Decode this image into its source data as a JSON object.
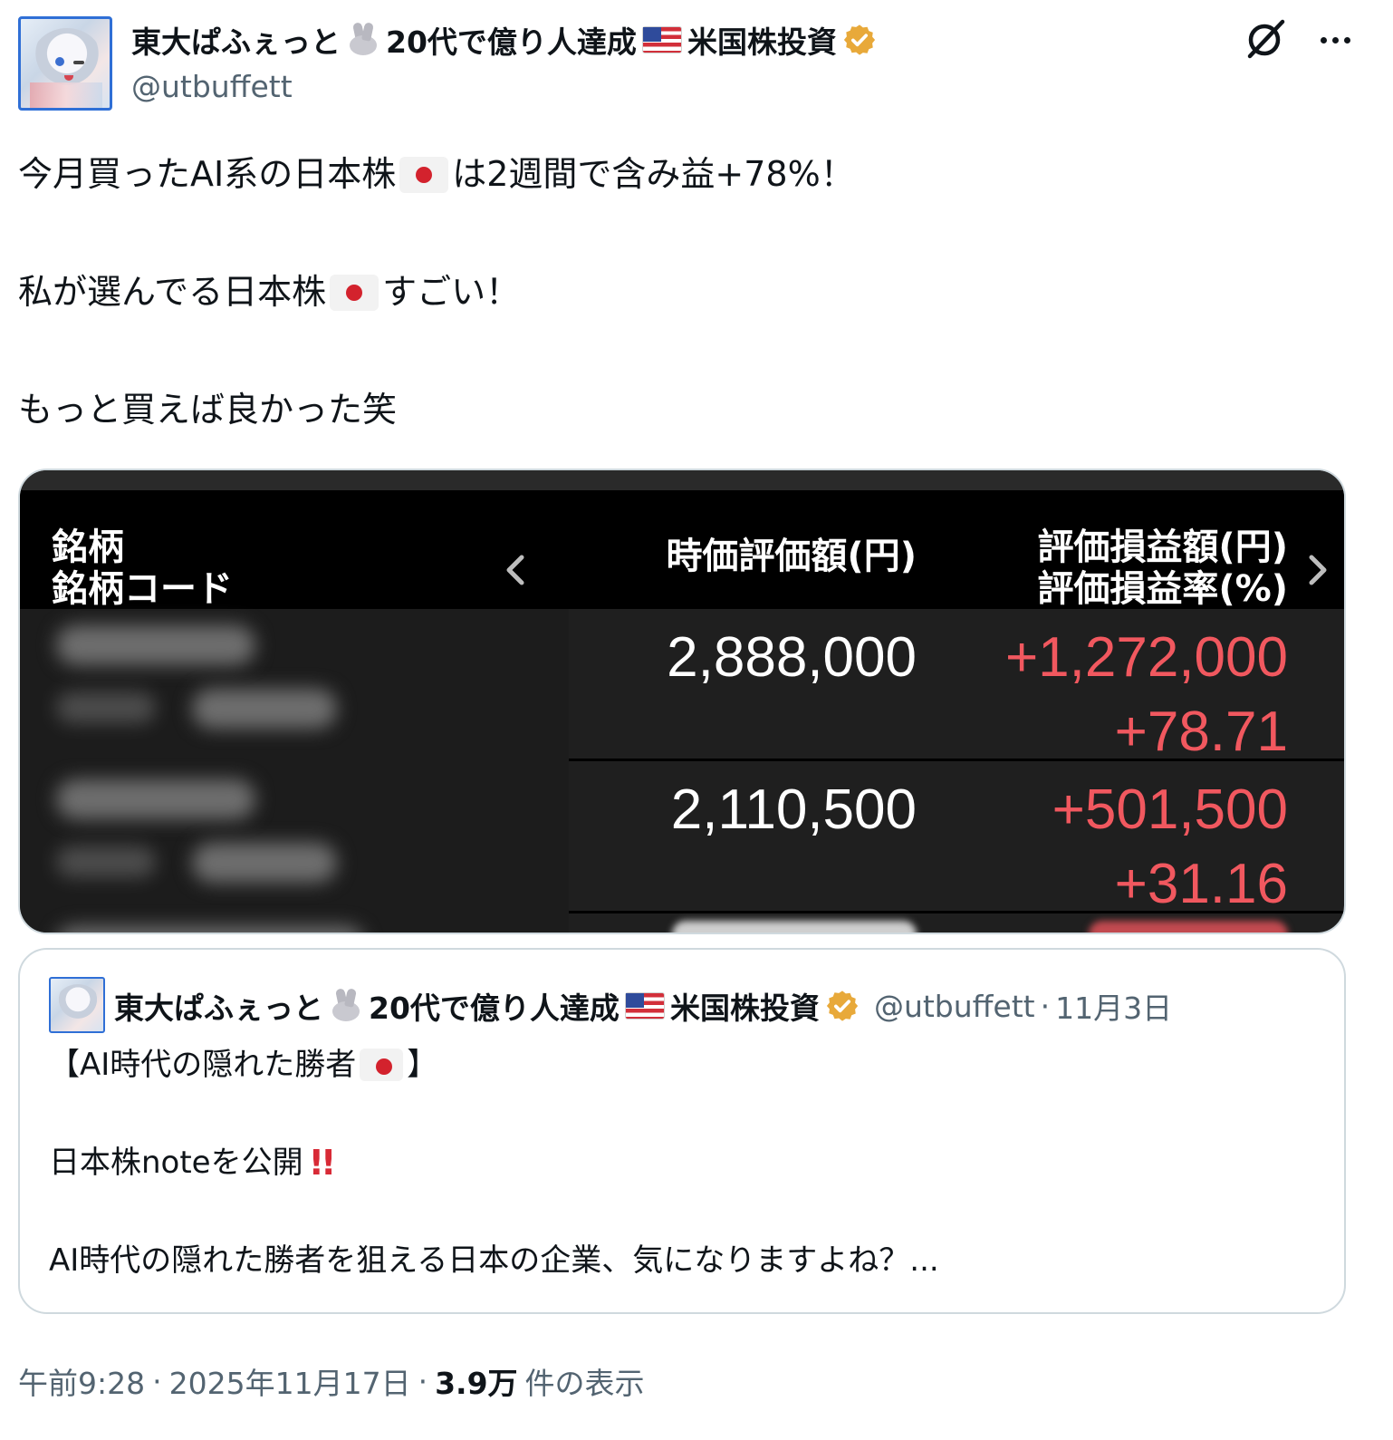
{
  "author": {
    "name_part1": "東大ぱふぇっと",
    "name_part2": "20代で億り人達成",
    "name_part3": "米国株投資",
    "handle": "@utbuffett"
  },
  "tweet": {
    "line1_before": "今月買ったAI系の日本株",
    "line1_after": "は2週間で含み益+78%！",
    "line2_before": "私が選んでる日本株",
    "line2_after": "すごい！",
    "line3": "もっと買えば良かった笑"
  },
  "media": {
    "header_name_line1": "銘柄",
    "header_name_line2": "銘柄コード",
    "header_price": "時価評価額(円)",
    "header_pl_line1": "評価損益額(円)",
    "header_pl_line2": "評価損益率(%)",
    "rows": [
      {
        "value": "2,888,000",
        "pl_amount": "+1,272,000",
        "pl_rate": "+78.71"
      },
      {
        "value": "2,110,500",
        "pl_amount": "+501,500",
        "pl_rate": "+31.16"
      }
    ]
  },
  "quote": {
    "name_part1": "東大ぱふぇっと",
    "name_part2": "20代で億り人達成",
    "name_part3": "米国株投資",
    "handle": "@utbuffett",
    "date": "11月3日",
    "line1_before": "【AI時代の隠れた勝者",
    "line1_after": "】",
    "line2": "日本株noteを公開",
    "line3": "AI時代の隠れた勝者を狙える日本の企業、気になりますよね？..."
  },
  "footer": {
    "time": "午前9:28",
    "date": "2025年11月17日",
    "views": "3.9万",
    "views_label": "件の表示"
  },
  "colors": {
    "profit_red": "#f1585f",
    "verified_gold": "#e8a93a",
    "secondary_text": "#536471"
  },
  "icons": [
    "grok-icon",
    "more-icon",
    "verified-badge-icon",
    "rabbit-emoji-icon",
    "us-flag-icon",
    "japan-flag-icon",
    "chevron-left-icon",
    "chevron-right-icon",
    "double-exclamation-icon"
  ]
}
